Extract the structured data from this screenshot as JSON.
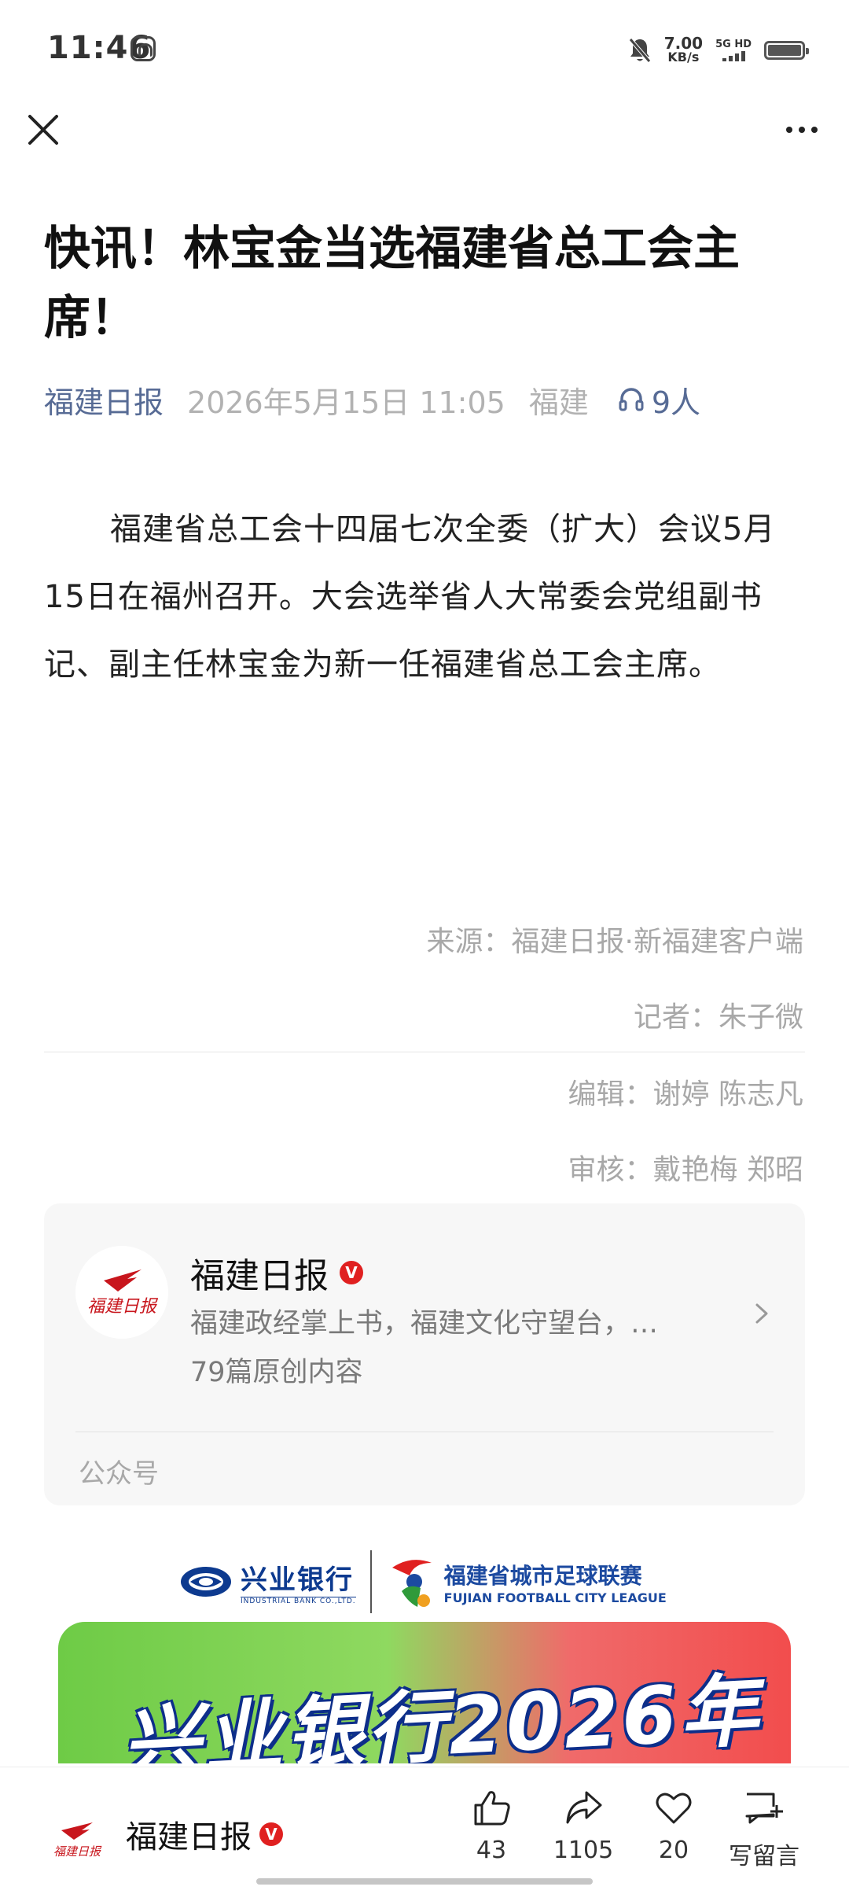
{
  "status_bar": {
    "time": "11:46",
    "net_speed_value": "7.00",
    "net_speed_unit": "KB/s",
    "signal_label": "5G HD"
  },
  "nav": {
    "close_icon": "close-icon",
    "more_icon": "more-icon"
  },
  "article": {
    "title": "快讯！林宝金当选福建省总工会主席！",
    "source": "福建日报",
    "date": "2026年5月15日 11:05",
    "region": "福建",
    "listeners": "9人",
    "body": "福建省总工会十四届七次全委（扩大）会议5月15日在福州召开。大会选举省人大常委会党组副书记、副主任林宝金为新一任福建省总工会主席。",
    "credits": {
      "source_line": "来源：福建日报·新福建客户端",
      "reporter_line": "记者：朱子微",
      "editor_line": "编辑：谢婷 陈志凡",
      "review_line": "审核：戴艳梅 郑昭"
    }
  },
  "account_card": {
    "name": "福建日报",
    "verified": "V",
    "description": "福建政经掌上书，福建文化守望台，…",
    "original_count": "79篇原创内容",
    "footer": "公众号"
  },
  "ad": {
    "bank_name": "兴业银行",
    "bank_en": "INDUSTRIAL BANK CO.,LTD.",
    "league_name": "福建省城市足球联赛",
    "league_en": "FUJIAN FOOTBALL CITY LEAGUE",
    "headline": "兴业银行2026年"
  },
  "bottom_bar": {
    "account_name": "福建日报",
    "verified": "V",
    "like_count": "43",
    "share_count": "1105",
    "favorite_count": "20",
    "comment_label": "写留言"
  },
  "colors": {
    "link": "#576b95",
    "meta_gray": "#b2b2b2",
    "verified_red": "#e02020"
  }
}
